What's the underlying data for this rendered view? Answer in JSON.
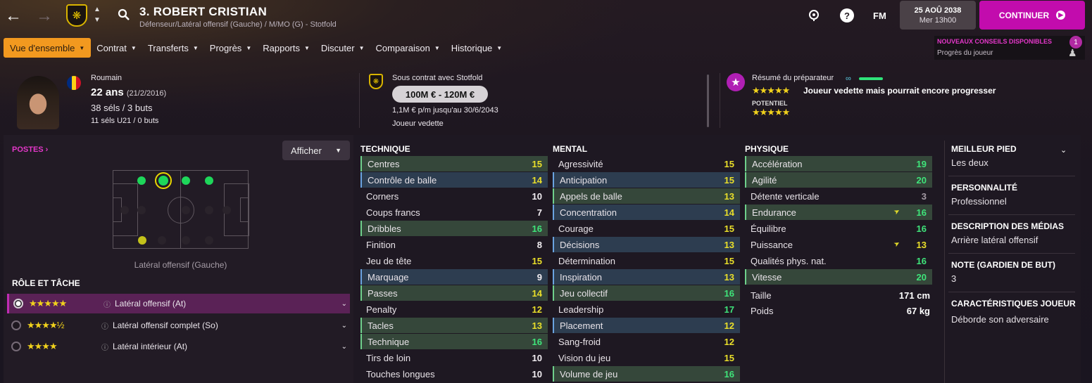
{
  "topbar": {
    "title": "3. ROBERT CRISTIAN",
    "subtitle": "Défenseur/Latéral offensif (Gauche) / M/MO (G) - Stotfold",
    "fm_label": "FM",
    "date": "25 AOÛ 2038",
    "day_time": "Mer 13h00",
    "continue_label": "CONTINUER"
  },
  "menu": [
    {
      "label": "Vue d'ensemble",
      "active": true
    },
    {
      "label": "Contrat"
    },
    {
      "label": "Transferts"
    },
    {
      "label": "Progrès"
    },
    {
      "label": "Rapports"
    },
    {
      "label": "Discuter"
    },
    {
      "label": "Comparaison"
    },
    {
      "label": "Historique"
    }
  ],
  "advice": {
    "title": "NOUVEAUX CONSEILS DISPONIBLES",
    "subtitle": "Progrès du joueur",
    "count": "1"
  },
  "player": {
    "nationality": "Roumain",
    "age": "22 ans",
    "dob": "(21/2/2016)",
    "caps": "38 séls / 3 buts",
    "u21_caps": "11 séls U21 / 0 buts"
  },
  "contract": {
    "status": "Sous contrat avec Stotfold",
    "value": "100M € - 120M €",
    "wage": "1,1M € p/m jusqu'au 30/6/2043",
    "status2": "Joueur vedette"
  },
  "coach": {
    "label": "Résumé du préparateur",
    "ability_stars": 5,
    "summary": "Joueur vedette mais pourrait encore progresser",
    "potential_label": "POTENTIEL",
    "potential_stars": 5
  },
  "positions": {
    "label": "POSTES",
    "afficher": "Afficher",
    "position_name": "Latéral offensif (Gauche)"
  },
  "roles": {
    "title": "RÔLE ET TÂCHE",
    "items": [
      {
        "label": "Latéral offensif (At)",
        "stars": "★★★★★",
        "selected": true
      },
      {
        "label": "Latéral offensif complet (So)",
        "stars": "★★★★½",
        "selected": false
      },
      {
        "label": "Latéral intérieur (At)",
        "stars": "★★★★",
        "selected": false
      }
    ]
  },
  "technique": {
    "title": "TECHNIQUE",
    "rows": [
      {
        "name": "Centres",
        "value": "15",
        "hl": "green"
      },
      {
        "name": "Contrôle de balle",
        "value": "14",
        "hl": "blue"
      },
      {
        "name": "Corners",
        "value": "10",
        "hl": ""
      },
      {
        "name": "Coups francs",
        "value": "7",
        "hl": ""
      },
      {
        "name": "Dribbles",
        "value": "16",
        "hl": "green"
      },
      {
        "name": "Finition",
        "value": "8",
        "hl": ""
      },
      {
        "name": "Jeu de tête",
        "value": "15",
        "hl": ""
      },
      {
        "name": "Marquage",
        "value": "9",
        "hl": "blue"
      },
      {
        "name": "Passes",
        "value": "14",
        "hl": "green"
      },
      {
        "name": "Penalty",
        "value": "12",
        "hl": ""
      },
      {
        "name": "Tacles",
        "value": "13",
        "hl": "green"
      },
      {
        "name": "Technique",
        "value": "16",
        "hl": "green"
      },
      {
        "name": "Tirs de loin",
        "value": "10",
        "hl": ""
      },
      {
        "name": "Touches longues",
        "value": "10",
        "hl": ""
      }
    ]
  },
  "mental": {
    "title": "MENTAL",
    "rows": [
      {
        "name": "Agressivité",
        "value": "15",
        "hl": ""
      },
      {
        "name": "Anticipation",
        "value": "15",
        "hl": "blue"
      },
      {
        "name": "Appels de balle",
        "value": "13",
        "hl": "green"
      },
      {
        "name": "Concentration",
        "value": "14",
        "hl": "blue"
      },
      {
        "name": "Courage",
        "value": "15",
        "hl": ""
      },
      {
        "name": "Décisions",
        "value": "13",
        "hl": "blue"
      },
      {
        "name": "Détermination",
        "value": "15",
        "hl": ""
      },
      {
        "name": "Inspiration",
        "value": "13",
        "hl": "blue"
      },
      {
        "name": "Jeu collectif",
        "value": "16",
        "hl": "green"
      },
      {
        "name": "Leadership",
        "value": "17",
        "hl": ""
      },
      {
        "name": "Placement",
        "value": "12",
        "hl": "blue"
      },
      {
        "name": "Sang-froid",
        "value": "12",
        "hl": ""
      },
      {
        "name": "Vision du jeu",
        "value": "15",
        "hl": ""
      },
      {
        "name": "Volume de jeu",
        "value": "16",
        "hl": "green"
      }
    ]
  },
  "physique": {
    "title": "PHYSIQUE",
    "rows": [
      {
        "name": "Accélération",
        "value": "19",
        "hl": "green"
      },
      {
        "name": "Agilité",
        "value": "20",
        "hl": "green"
      },
      {
        "name": "Détente verticale",
        "value": "3",
        "hl": ""
      },
      {
        "name": "Endurance",
        "value": "16",
        "hl": "green",
        "trend": true
      },
      {
        "name": "Équilibre",
        "value": "16",
        "hl": ""
      },
      {
        "name": "Puissance",
        "value": "13",
        "hl": "",
        "trend": true
      },
      {
        "name": "Qualités phys. nat.",
        "value": "16",
        "hl": ""
      },
      {
        "name": "Vitesse",
        "value": "20",
        "hl": "green"
      }
    ],
    "height_label": "Taille",
    "height": "171 cm",
    "weight_label": "Poids",
    "weight": "67 kg"
  },
  "info": [
    {
      "head": "MEILLEUR PIED",
      "val": "Les deux"
    },
    {
      "head": "PERSONNALITÉ",
      "val": "Professionnel"
    },
    {
      "head": "DESCRIPTION DES MÉDIAS",
      "val": "Arrière latéral offensif"
    },
    {
      "head": "NOTE (GARDIEN DE BUT)",
      "val": "3"
    },
    {
      "head": "CARACTÉRISTIQUES JOUEUR",
      "val": "Déborde son adversaire"
    }
  ],
  "colors": {
    "accent": "#c20cad",
    "menu_active": "#f2991f",
    "green": "#3fe47a",
    "yellow": "#eadf2a"
  }
}
